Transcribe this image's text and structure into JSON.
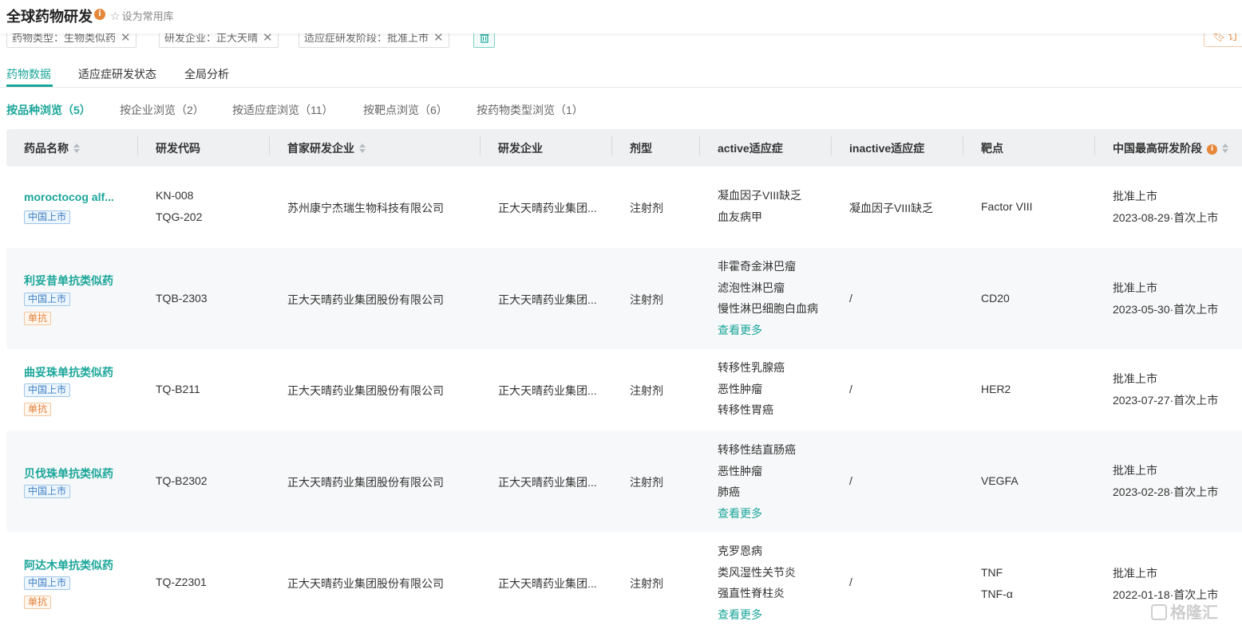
{
  "header": {
    "title": "全球药物研发",
    "info_icon": "info-circle-icon",
    "favorite_label": "设为常用库"
  },
  "filters": {
    "chips": [
      "药物类型：生物类似药",
      "研发企业：正大天晴",
      "适应症研发阶段：批准上市"
    ],
    "subscribe_label": "订"
  },
  "tabs": [
    "药物数据",
    "适应症研发状态",
    "全局分析"
  ],
  "subtabs": [
    "按品种浏览（5）",
    "按企业浏览（2）",
    "按适应症浏览（11）",
    "按靶点浏览（6）",
    "按药物类型浏览（1）"
  ],
  "table": {
    "columns": [
      "药品名称",
      "研发代码",
      "首家研发企业",
      "研发企业",
      "剂型",
      "active适应症",
      "inactive适应症",
      "靶点",
      "中国最高研发阶段"
    ],
    "rows": [
      {
        "name": "moroctocog alf...",
        "badges": [
          "中国上市"
        ],
        "codes": [
          "KN-008",
          "TQG-202"
        ],
        "first_company": "苏州康宁杰瑞生物科技有限公司",
        "company": "正大天晴药业集团...",
        "form": "注射剂",
        "active": [
          "凝血因子VIII缺乏",
          "血友病甲"
        ],
        "active_more": "",
        "inactive": "凝血因子VIII缺乏",
        "targets": [
          "Factor VIII"
        ],
        "stage": "批准上市",
        "stage_date": "2023-08-29·首次上市"
      },
      {
        "name": "利妥昔单抗类似药",
        "badges": [
          "中国上市",
          "单抗"
        ],
        "codes": [
          "TQB-2303"
        ],
        "first_company": "正大天晴药业集团股份有限公司",
        "company": "正大天晴药业集团...",
        "form": "注射剂",
        "active": [
          "非霍奇金淋巴瘤",
          "滤泡性淋巴瘤",
          "慢性淋巴细胞白血病"
        ],
        "active_more": "查看更多",
        "inactive": "/",
        "targets": [
          "CD20"
        ],
        "stage": "批准上市",
        "stage_date": "2023-05-30·首次上市"
      },
      {
        "name": "曲妥珠单抗类似药",
        "badges": [
          "中国上市",
          "单抗"
        ],
        "codes": [
          "TQ-B211"
        ],
        "first_company": "正大天晴药业集团股份有限公司",
        "company": "正大天晴药业集团...",
        "form": "注射剂",
        "active": [
          "转移性乳腺癌",
          "恶性肿瘤",
          "转移性胃癌"
        ],
        "active_more": "",
        "inactive": "/",
        "targets": [
          "HER2"
        ],
        "stage": "批准上市",
        "stage_date": "2023-07-27·首次上市"
      },
      {
        "name": "贝伐珠单抗类似药",
        "badges": [
          "中国上市"
        ],
        "codes": [
          "TQ-B2302"
        ],
        "first_company": "正大天晴药业集团股份有限公司",
        "company": "正大天晴药业集团...",
        "form": "注射剂",
        "active": [
          "转移性结直肠癌",
          "恶性肿瘤",
          "肺癌"
        ],
        "active_more": "查看更多",
        "inactive": "/",
        "targets": [
          "VEGFA"
        ],
        "stage": "批准上市",
        "stage_date": "2023-02-28·首次上市"
      },
      {
        "name": "阿达木单抗类似药",
        "badges": [
          "中国上市",
          "单抗"
        ],
        "codes": [
          "TQ-Z2301"
        ],
        "first_company": "正大天晴药业集团股份有限公司",
        "company": "正大天晴药业集团...",
        "form": "注射剂",
        "active": [
          "克罗恩病",
          "类风湿性关节炎",
          "强直性脊柱炎"
        ],
        "active_more": "查看更多",
        "inactive": "/",
        "targets": [
          "TNF",
          "TNF-α"
        ],
        "stage": "批准上市",
        "stage_date": "2022-01-18·首次上市"
      }
    ]
  },
  "watermark": "格隆汇",
  "colors": {
    "accent": "#1ba69a",
    "warning": "#e6873a",
    "badge_blue": "#3d7fc4",
    "header_bg": "#eef0f2"
  }
}
